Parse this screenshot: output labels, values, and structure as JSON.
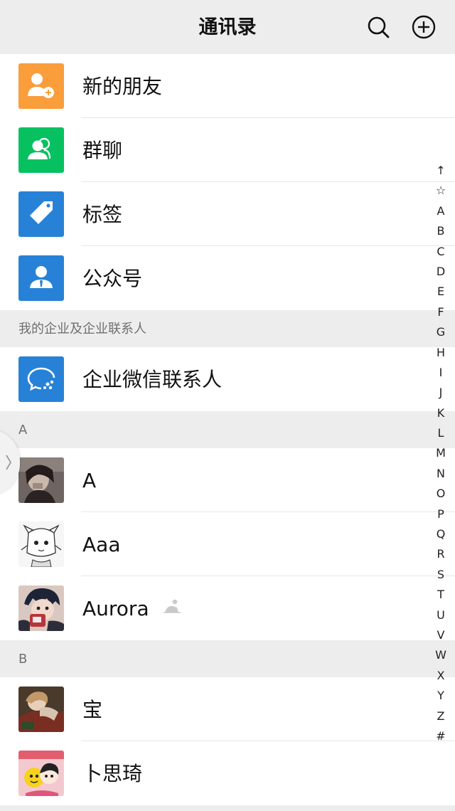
{
  "header": {
    "title": "通讯录",
    "search_icon": "search-icon",
    "add_icon": "plus-circle-icon"
  },
  "functions": [
    {
      "label": "新的朋友",
      "icon": "new-friend-icon",
      "color": "#fa9d3b"
    },
    {
      "label": "群聊",
      "icon": "group-chat-icon",
      "color": "#07c160"
    },
    {
      "label": "标签",
      "icon": "tag-icon",
      "color": "#2782d7"
    },
    {
      "label": "公众号",
      "icon": "official-account-icon",
      "color": "#2782d7"
    }
  ],
  "enterprise": {
    "header": "我的企业及企业联系人",
    "item": {
      "label": "企业微信联系人",
      "icon": "work-chat-icon",
      "color": "#2782d7"
    }
  },
  "groups": [
    {
      "letter": "A",
      "contacts": [
        {
          "name": "A",
          "avatar": "photo-avatar"
        },
        {
          "name": "Aaa",
          "avatar": "sketch-avatar"
        },
        {
          "name": "Aurora",
          "avatar": "anime-avatar",
          "badge": "gender-icon"
        }
      ]
    },
    {
      "letter": "B",
      "contacts": [
        {
          "name": "宝",
          "avatar": "anime-avatar"
        },
        {
          "name": "卜思琦",
          "avatar": "cartoon-avatar"
        }
      ]
    }
  ],
  "index_bar": [
    "↑",
    "☆",
    "A",
    "B",
    "C",
    "D",
    "E",
    "F",
    "G",
    "H",
    "I",
    "J",
    "K",
    "L",
    "M",
    "N",
    "O",
    "P",
    "Q",
    "R",
    "S",
    "T",
    "U",
    "V",
    "W",
    "X",
    "Y",
    "Z",
    "#"
  ],
  "side_handle_icon": "chevron-right-icon"
}
